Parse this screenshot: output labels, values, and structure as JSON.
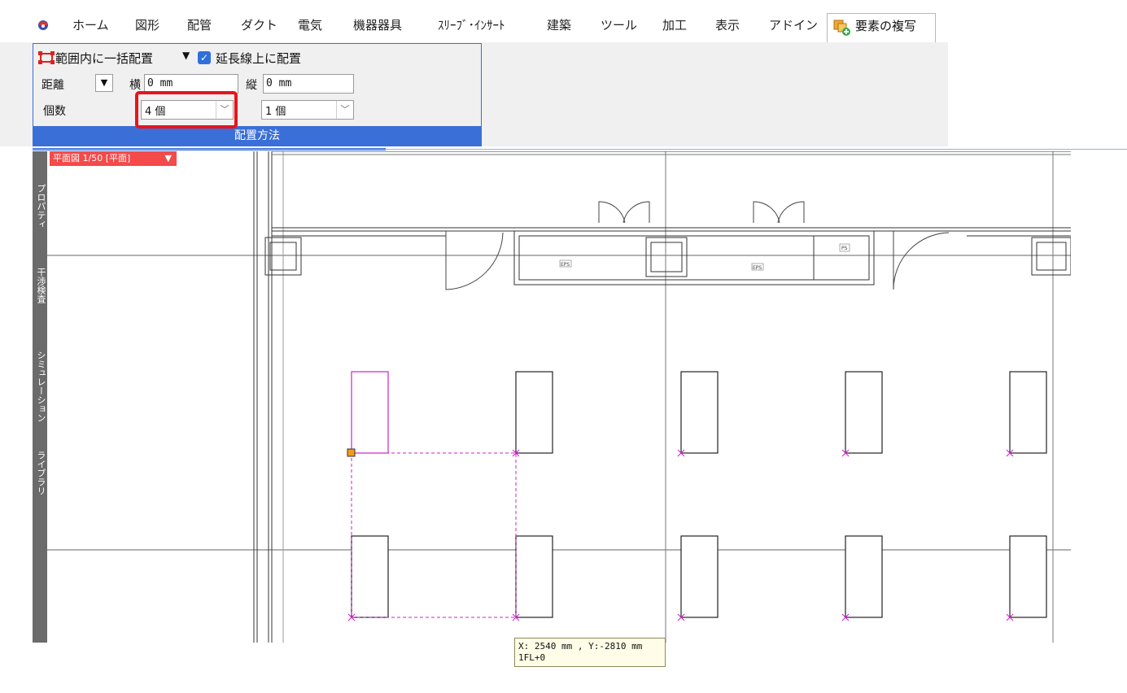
{
  "menubar": {
    "items": [
      "ホーム",
      "図形",
      "配管",
      "ダクト",
      "電気",
      "機器器具",
      "ｽﾘｰﾌﾞ･ｲﾝｻｰﾄ",
      "建築",
      "ツール",
      "加工",
      "表示",
      "アドイン"
    ],
    "active_tab": "要素の複写"
  },
  "ribbon": {
    "placement_mode": "範囲内に一括配置",
    "extend_checkbox_label": "延長線上に配置",
    "extend_checked": true,
    "distance_label": "距離",
    "horizontal_label": "横",
    "horizontal_value": "0 mm",
    "vertical_label": "縦",
    "vertical_value": "0 mm",
    "count_label": "個数",
    "count_h": "4 個",
    "count_v": "1 個",
    "group_caption": "配置方法"
  },
  "view": {
    "badge": "平面図 1/50 [平面]",
    "side_tabs": [
      "プロパティ",
      "干渉検査",
      "シミュレーション",
      "ライブラリ"
    ],
    "room_labels": [
      "EPS",
      "EPS",
      "PS"
    ]
  },
  "tooltip": {
    "line1": "X: 2540 mm , Y:-2810 mm",
    "line2": "1FL+0"
  },
  "colors": {
    "accent": "#3a6fd8",
    "highlight": "#e8141c",
    "selection": "#d020c8",
    "badge": "#f44a4a"
  }
}
